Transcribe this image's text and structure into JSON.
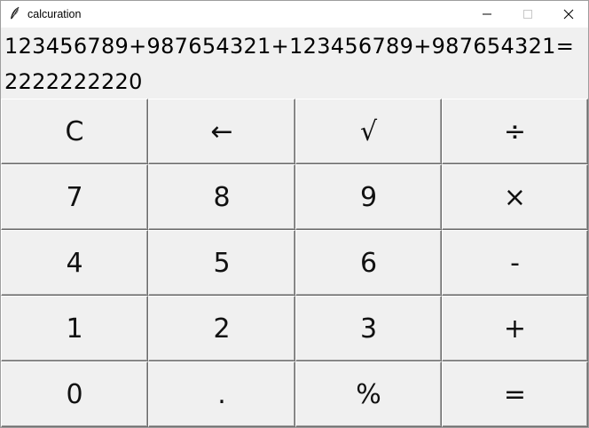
{
  "window": {
    "title": "calcuration",
    "controls": {
      "minimize": "minimize-icon",
      "maximize": "maximize-icon",
      "close": "close-icon"
    }
  },
  "display": {
    "expression": "123456789+987654321+123456789+987654321=",
    "result": "2222222220"
  },
  "keys": [
    {
      "label": "C",
      "name": "clear-button"
    },
    {
      "label": "←",
      "name": "backspace-button"
    },
    {
      "label": "√",
      "name": "sqrt-button"
    },
    {
      "label": "÷",
      "name": "divide-button"
    },
    {
      "label": "7",
      "name": "digit-7-button"
    },
    {
      "label": "8",
      "name": "digit-8-button"
    },
    {
      "label": "9",
      "name": "digit-9-button"
    },
    {
      "label": "×",
      "name": "multiply-button"
    },
    {
      "label": "4",
      "name": "digit-4-button"
    },
    {
      "label": "5",
      "name": "digit-5-button"
    },
    {
      "label": "6",
      "name": "digit-6-button"
    },
    {
      "label": "-",
      "name": "subtract-button"
    },
    {
      "label": "1",
      "name": "digit-1-button"
    },
    {
      "label": "2",
      "name": "digit-2-button"
    },
    {
      "label": "3",
      "name": "digit-3-button"
    },
    {
      "label": "+",
      "name": "add-button"
    },
    {
      "label": "0",
      "name": "digit-0-button"
    },
    {
      "label": ".",
      "name": "decimal-point-button"
    },
    {
      "label": "%",
      "name": "percent-button"
    },
    {
      "label": "=",
      "name": "equals-button"
    }
  ]
}
